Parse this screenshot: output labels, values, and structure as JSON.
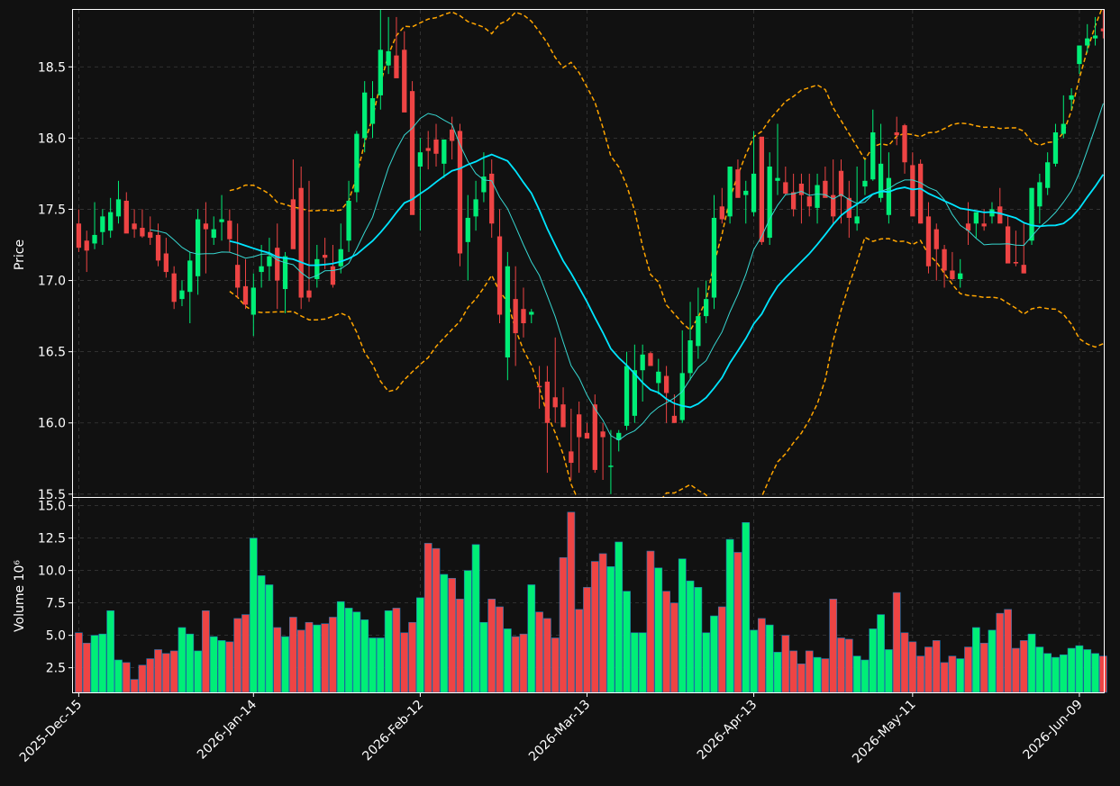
{
  "chart_data": {
    "type": "candlestick",
    "dates": [
      "2025-12-15",
      "2025-12-16",
      "2025-12-17",
      "2025-12-18",
      "2025-12-19",
      "2025-12-22",
      "2025-12-23",
      "2025-12-24",
      "2025-12-25",
      "2025-12-26",
      "2025-12-29",
      "2025-12-30",
      "2025-12-31",
      "2026-01-01",
      "2026-01-02",
      "2026-01-05",
      "2026-01-06",
      "2026-01-07",
      "2026-01-08",
      "2026-01-09",
      "2026-01-12",
      "2026-01-13",
      "2026-01-14",
      "2026-01-15",
      "2026-01-16",
      "2026-01-19",
      "2026-01-20",
      "2026-01-21",
      "2026-01-22",
      "2026-01-23",
      "2026-01-26",
      "2026-01-27",
      "2026-01-28",
      "2026-01-29",
      "2026-01-30",
      "2026-02-02",
      "2026-02-03",
      "2026-02-04",
      "2026-02-05",
      "2026-02-06",
      "2026-02-09",
      "2026-02-10",
      "2026-02-11",
      "2026-02-12",
      "2026-02-13",
      "2026-02-16",
      "2026-02-17",
      "2026-02-18",
      "2026-02-19",
      "2026-02-20",
      "2026-02-23",
      "2026-02-24",
      "2026-02-25",
      "2026-02-26",
      "2026-02-27",
      "2026-03-02",
      "2026-03-03",
      "2026-03-04",
      "2026-03-05",
      "2026-03-06",
      "2026-03-09",
      "2026-03-10",
      "2026-03-11",
      "2026-03-12",
      "2026-03-13",
      "2026-03-16",
      "2026-03-17",
      "2026-03-18",
      "2026-03-19",
      "2026-03-20",
      "2026-03-23",
      "2026-03-24",
      "2026-03-25",
      "2026-03-26",
      "2026-03-27",
      "2026-03-30",
      "2026-03-31",
      "2026-04-01",
      "2026-04-02",
      "2026-04-03",
      "2026-04-06",
      "2026-04-07",
      "2026-04-08",
      "2026-04-09",
      "2026-04-10",
      "2026-04-13",
      "2026-04-14",
      "2026-04-15",
      "2026-04-16",
      "2026-04-17",
      "2026-04-20",
      "2026-04-21",
      "2026-04-22",
      "2026-04-23",
      "2026-04-24",
      "2026-04-27",
      "2026-04-28",
      "2026-04-29",
      "2026-04-30",
      "2026-05-01",
      "2026-05-04",
      "2026-05-05",
      "2026-05-06",
      "2026-05-07",
      "2026-05-08",
      "2026-05-11",
      "2026-05-12",
      "2026-05-13",
      "2026-05-14",
      "2026-05-15",
      "2026-05-18",
      "2026-05-19",
      "2026-05-20",
      "2026-05-21",
      "2026-05-22",
      "2026-05-25",
      "2026-05-26",
      "2026-05-27",
      "2026-05-28",
      "2026-05-29",
      "2026-06-01",
      "2026-06-02",
      "2026-06-03",
      "2026-06-04",
      "2026-06-05",
      "2026-06-08",
      "2026-06-09",
      "2026-06-10",
      "2026-06-11",
      "2026-06-12"
    ],
    "open": [
      17.4,
      17.28,
      17.26,
      17.34,
      17.35,
      17.45,
      17.56,
      17.4,
      17.37,
      17.34,
      17.32,
      17.19,
      17.05,
      16.87,
      16.92,
      17.03,
      17.4,
      17.3,
      17.41,
      17.42,
      17.11,
      16.96,
      16.76,
      17.06,
      17.1,
      17.23,
      16.94,
      17.57,
      17.65,
      16.93,
      17.01,
      17.18,
      17.1,
      17.1,
      17.28,
      17.62,
      18.0,
      18.1,
      18.3,
      18.51,
      18.58,
      18.62,
      18.33,
      17.8,
      17.93,
      17.99,
      17.82,
      18.06,
      18.05,
      17.27,
      17.45,
      17.62,
      17.75,
      17.31,
      16.46,
      16.87,
      16.8,
      16.76,
      16.26,
      16.29,
      16.18,
      16.13,
      15.8,
      16.06,
      15.93,
      16.13,
      15.94,
      15.7,
      15.88,
      15.98,
      16.05,
      16.37,
      16.49,
      16.28,
      16.33,
      16.05,
      16.02,
      16.35,
      16.54,
      16.75,
      16.88,
      17.52,
      17.45,
      17.78,
      17.6,
      17.48,
      18.01,
      17.3,
      17.7,
      17.69,
      17.62,
      17.68,
      17.59,
      17.51,
      17.7,
      17.6,
      17.77,
      17.58,
      17.4,
      17.66,
      17.71,
      17.58,
      17.46,
      18.04,
      18.09,
      17.81,
      17.82,
      17.45,
      17.36,
      17.22,
      17.07,
      17.01,
      17.4,
      17.4,
      17.4,
      17.45,
      17.52,
      17.38,
      17.13,
      17.11,
      17.28,
      17.52,
      17.65,
      17.82,
      18.03,
      18.27,
      18.52,
      18.65,
      18.7,
      18.77
    ],
    "high": [
      17.5,
      17.35,
      17.55,
      17.5,
      17.58,
      17.7,
      17.62,
      17.5,
      17.5,
      17.45,
      17.4,
      17.3,
      17.1,
      17.0,
      17.2,
      17.5,
      17.55,
      17.45,
      17.6,
      17.5,
      17.4,
      17.15,
      17.05,
      17.25,
      17.3,
      17.4,
      17.2,
      17.85,
      17.8,
      17.7,
      17.25,
      17.3,
      17.25,
      17.4,
      17.7,
      18.05,
      18.4,
      18.4,
      18.9,
      18.85,
      18.85,
      18.75,
      18.4,
      18.0,
      18.05,
      18.1,
      17.95,
      18.15,
      18.1,
      17.6,
      17.7,
      17.9,
      17.85,
      17.5,
      17.2,
      17.1,
      16.95,
      16.8,
      16.4,
      16.4,
      16.6,
      16.25,
      16.1,
      16.15,
      16.0,
      16.2,
      16.0,
      15.95,
      15.95,
      16.5,
      16.55,
      16.55,
      16.5,
      16.45,
      16.4,
      16.2,
      16.65,
      16.85,
      16.95,
      17.0,
      17.6,
      17.65,
      17.8,
      17.85,
      17.7,
      18.05,
      18.0,
      17.9,
      18.1,
      17.8,
      17.75,
      17.75,
      17.75,
      17.75,
      17.8,
      17.85,
      17.85,
      17.7,
      17.8,
      17.85,
      18.2,
      18.1,
      17.9,
      18.15,
      18.1,
      17.9,
      17.85,
      17.55,
      17.4,
      17.25,
      17.2,
      17.15,
      17.55,
      17.45,
      17.5,
      17.55,
      17.65,
      17.45,
      17.35,
      17.4,
      17.65,
      17.75,
      17.9,
      18.1,
      18.3,
      18.35,
      18.65,
      18.8,
      18.85,
      18.9
    ],
    "low": [
      17.2,
      17.06,
      17.22,
      17.25,
      17.3,
      17.4,
      17.35,
      17.3,
      17.3,
      17.25,
      17.1,
      17.02,
      16.8,
      16.82,
      16.7,
      16.9,
      17.05,
      17.25,
      17.28,
      17.2,
      16.88,
      16.8,
      16.61,
      16.95,
      17.0,
      16.8,
      16.77,
      17.48,
      16.8,
      16.85,
      16.95,
      17.08,
      16.95,
      17.05,
      17.2,
      17.55,
      17.9,
      18.0,
      18.2,
      18.45,
      18.5,
      18.3,
      18.08,
      17.35,
      17.78,
      17.8,
      17.72,
      17.85,
      17.1,
      17.0,
      17.35,
      17.55,
      17.3,
      16.7,
      16.3,
      16.4,
      16.6,
      16.7,
      16.1,
      15.65,
      16.0,
      16.05,
      15.6,
      15.65,
      15.9,
      15.65,
      15.6,
      15.5,
      15.8,
      15.95,
      16.0,
      16.15,
      16.4,
      16.2,
      16.0,
      16.0,
      16.0,
      16.3,
      16.45,
      16.7,
      16.8,
      17.4,
      17.4,
      17.6,
      17.4,
      17.45,
      17.25,
      17.25,
      17.6,
      17.6,
      17.45,
      17.4,
      17.45,
      17.4,
      17.6,
      17.4,
      17.4,
      17.3,
      17.35,
      17.6,
      17.7,
      17.55,
      17.4,
      17.95,
      17.75,
      17.7,
      17.4,
      17.05,
      17.0,
      16.95,
      17.0,
      16.95,
      17.25,
      17.3,
      17.35,
      17.4,
      17.5,
      17.3,
      17.1,
      17.05,
      17.25,
      17.4,
      17.6,
      17.8,
      18.0,
      18.2,
      18.45,
      18.6,
      18.65,
      18.7
    ],
    "close": [
      17.23,
      17.21,
      17.32,
      17.45,
      17.48,
      17.57,
      17.33,
      17.36,
      17.31,
      17.3,
      17.14,
      17.06,
      16.85,
      16.93,
      17.14,
      17.43,
      17.36,
      17.36,
      17.43,
      17.29,
      16.95,
      16.83,
      16.95,
      17.1,
      17.17,
      17.0,
      17.17,
      17.22,
      16.88,
      16.88,
      17.15,
      17.16,
      16.97,
      17.22,
      17.56,
      18.03,
      18.32,
      18.28,
      18.62,
      18.61,
      18.42,
      18.18,
      17.46,
      17.9,
      17.91,
      17.89,
      17.99,
      17.98,
      17.19,
      17.44,
      17.57,
      17.73,
      17.4,
      16.76,
      17.1,
      16.63,
      16.7,
      16.78,
      16.25,
      16.0,
      16.11,
      15.97,
      15.72,
      15.9,
      15.89,
      15.67,
      15.9,
      15.7,
      15.93,
      16.4,
      16.37,
      16.48,
      16.4,
      16.36,
      16.21,
      16.0,
      16.35,
      16.58,
      16.75,
      16.87,
      17.44,
      17.43,
      17.8,
      17.58,
      17.63,
      17.75,
      17.27,
      17.8,
      17.72,
      17.61,
      17.5,
      17.6,
      17.52,
      17.67,
      17.58,
      17.45,
      17.59,
      17.44,
      17.45,
      17.7,
      18.04,
      17.82,
      17.72,
      18.02,
      17.83,
      17.45,
      17.4,
      17.1,
      17.22,
      17.07,
      17.01,
      17.05,
      17.35,
      17.48,
      17.38,
      17.5,
      17.4,
      17.12,
      17.12,
      17.05,
      17.65,
      17.69,
      17.83,
      18.04,
      18.1,
      18.3,
      18.65,
      18.7,
      18.72,
      18.75
    ],
    "volume": [
      5.2,
      4.4,
      5.0,
      5.1,
      6.9,
      3.1,
      2.9,
      1.6,
      2.7,
      3.2,
      3.9,
      3.6,
      3.8,
      5.6,
      5.1,
      3.8,
      6.9,
      4.9,
      4.6,
      4.5,
      6.3,
      6.6,
      12.5,
      9.6,
      8.9,
      5.6,
      4.9,
      6.4,
      5.4,
      6.0,
      5.8,
      5.9,
      6.4,
      7.6,
      7.1,
      6.8,
      6.2,
      4.8,
      4.8,
      6.9,
      7.1,
      5.2,
      6.0,
      7.9,
      12.1,
      11.7,
      9.7,
      9.4,
      7.8,
      10.0,
      12.0,
      6.0,
      7.8,
      7.2,
      5.5,
      4.9,
      5.1,
      8.9,
      6.8,
      6.3,
      4.8,
      11.0,
      14.5,
      7.0,
      8.7,
      10.7,
      11.3,
      10.3,
      12.2,
      8.4,
      5.2,
      5.2,
      11.5,
      10.2,
      8.4,
      7.5,
      10.9,
      9.2,
      8.7,
      5.2,
      6.5,
      7.2,
      12.4,
      11.4,
      13.7,
      5.4,
      6.3,
      5.8,
      3.7,
      5.0,
      3.8,
      2.8,
      3.8,
      3.3,
      3.2,
      7.8,
      4.8,
      4.7,
      3.4,
      3.1,
      5.5,
      6.6,
      3.9,
      8.3,
      5.2,
      4.5,
      3.4,
      4.1,
      4.6,
      2.9,
      3.4,
      3.2,
      4.1,
      5.6,
      4.4,
      5.4,
      6.7,
      7.0,
      4.0,
      4.6,
      5.1,
      4.1,
      3.6,
      3.3,
      3.5,
      4.0,
      4.2,
      3.9,
      3.6,
      3.4
    ],
    "xtick_labels": [
      "2025-Dec-15",
      "2026-Jan-14",
      "2026-Feb-12",
      "2026-Mar-13",
      "2026-Apr-13",
      "2026-May-11",
      "2026-Jun-09"
    ],
    "price_axis": {
      "ylabel": "Price",
      "ticks": [
        "15.5",
        "16.0",
        "16.5",
        "17.0",
        "17.5",
        "18.0",
        "18.5"
      ],
      "ylim": [
        15.48,
        18.9
      ]
    },
    "volume_axis": {
      "ylabel": "Volume  10⁶",
      "ticks": [
        "2.5",
        "5.0",
        "7.5",
        "10.0",
        "12.5",
        "15.0"
      ],
      "ylim": [
        0.6,
        15.6
      ]
    },
    "ma_short": 10,
    "ma_long": 20,
    "bollinger": {
      "period": 20,
      "std": 2
    },
    "grid": true,
    "colors": {
      "up": "#00ee77",
      "down": "#ee4444",
      "ma_short": "#37d6d0",
      "ma_long": "#00e5ff",
      "bollinger": "#ffa500",
      "background": "#111111",
      "grid": "#3a3a3a",
      "axis": "#ffffff",
      "volume_edge": "#1f77b4"
    }
  }
}
